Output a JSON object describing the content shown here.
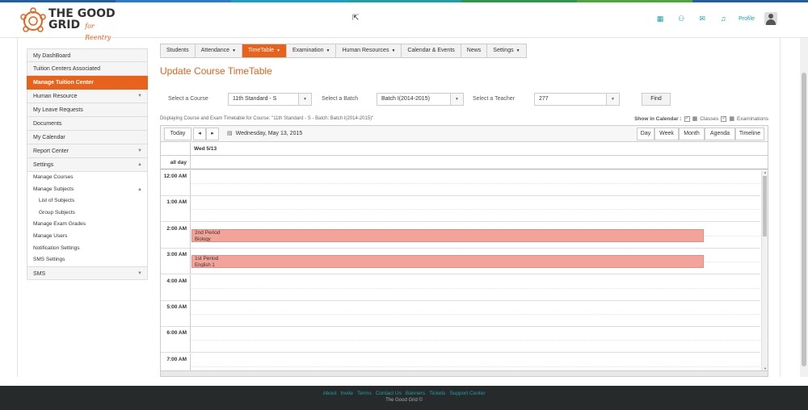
{
  "brand": {
    "name_line1": "THE GOOD",
    "name_line2": "GRID",
    "tagline": "for Reentry",
    "colors": {
      "accent": "#e8621c",
      "teal": "#1ba0a8",
      "footer_bg": "#262a2b"
    },
    "topbar_colors": [
      "#1e5fa8",
      "#2a7bd0",
      "#17a0c8",
      "#1ba0a8",
      "#2a9a4a",
      "#4aa83a",
      "#1e5fa8"
    ]
  },
  "header": {
    "icons": [
      "grid-icon",
      "users-icon",
      "mail-icon",
      "bell-icon"
    ],
    "profile_label": "Profile"
  },
  "sidebar": {
    "items": [
      {
        "label": "My DashBoard"
      },
      {
        "label": "Tuition Centers Associated"
      },
      {
        "label": "Manage Tuition Center",
        "active": true
      },
      {
        "label": "Human Resource",
        "caret": "▼"
      },
      {
        "label": "My Leave Requests"
      },
      {
        "label": "Documents"
      },
      {
        "label": "My Calendar"
      },
      {
        "label": "Report Center",
        "caret": "▼"
      },
      {
        "label": "Settings",
        "caret": "▲"
      }
    ],
    "settings_sub": [
      {
        "label": "Manage Courses"
      },
      {
        "label": "Manage Subjects",
        "caret": "▲"
      },
      {
        "label": "List of Subjects",
        "deep": true
      },
      {
        "label": "Group Subjects",
        "deep": true
      },
      {
        "label": "Manage Exam Grades"
      },
      {
        "label": "Manage Users"
      },
      {
        "label": "Notification Settings"
      },
      {
        "label": "SMS Settings"
      }
    ],
    "sms": {
      "label": "SMS",
      "caret": "▼"
    }
  },
  "tabs": [
    {
      "label": "Students"
    },
    {
      "label": "Attendance",
      "dd": "▼"
    },
    {
      "label": "TimeTable",
      "dd": "▼",
      "active": true
    },
    {
      "label": "Examination",
      "dd": "▼"
    },
    {
      "label": "Human Resources",
      "dd": "▼"
    },
    {
      "label": "Calendar & Events"
    },
    {
      "label": "News"
    },
    {
      "label": "Settings",
      "dd": "▼"
    }
  ],
  "page_title": "Update Course TimeTable",
  "filters": {
    "course_label": "Select a Course",
    "course_value": "11th Standard - S",
    "batch_label": "Select a Batch",
    "batch_value": "Batch I(2014-2015)",
    "teacher_label": "Select a Teacher",
    "teacher_value": "277",
    "find_label": "Find"
  },
  "displaying_text": "Displaying Course and Exam Timetable for Course: \"11th Standard - S - Batch: Batch I(2014-2015)\"",
  "show_in": {
    "label": "Show in Calendar :",
    "classes": "Classes",
    "examinations": "Examinations"
  },
  "calendar": {
    "today_label": "Today",
    "prev": "◂",
    "next": "▸",
    "date_label": "Wednesday, May 13, 2015",
    "views": [
      "Day",
      "Week",
      "Month",
      "Agenda",
      "Timeline"
    ],
    "day_header": "Wed 5/13",
    "all_day_label": "all day",
    "hours": [
      "12:00 AM",
      "1:00 AM",
      "2:00 AM",
      "3:00 AM",
      "4:00 AM",
      "5:00 AM",
      "6:00 AM",
      "7:00 AM"
    ],
    "events": [
      {
        "title": "2nd Period",
        "subtitle": "Biology",
        "hour_index": 2
      },
      {
        "title": "1st Period",
        "subtitle": "English 1",
        "hour_index": 3
      }
    ]
  },
  "footer": {
    "links": [
      "About",
      "Invite",
      "Terms",
      "Contact Us",
      "Banners",
      "Tickets",
      "Support Center"
    ],
    "copyright": "The Good Grid ©"
  }
}
